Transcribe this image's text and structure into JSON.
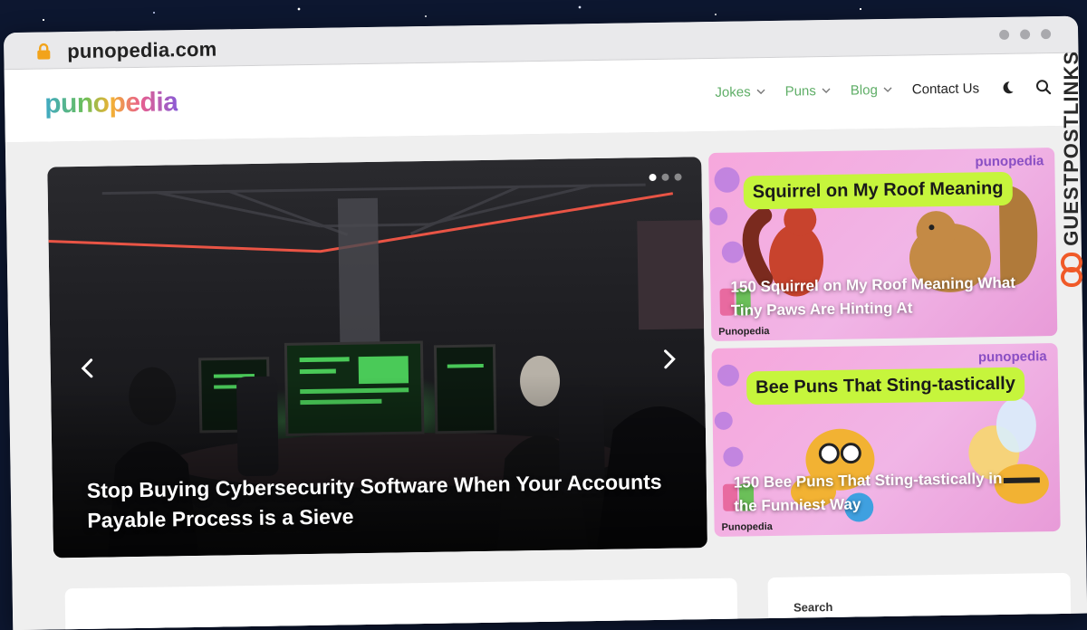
{
  "browser": {
    "url": "punopedia.com"
  },
  "site": {
    "logo": "punopedia"
  },
  "nav": {
    "items": [
      {
        "label": "Jokes",
        "has_dropdown": true
      },
      {
        "label": "Puns",
        "has_dropdown": true
      },
      {
        "label": "Blog",
        "has_dropdown": true
      },
      {
        "label": "Contact Us",
        "has_dropdown": false
      }
    ],
    "accent_color": "#5fae67"
  },
  "hero": {
    "title": "Stop Buying Cybersecurity Software When Your Accounts Payable Process is a Sieve",
    "slide_count": 3,
    "active_slide": 1
  },
  "cards": [
    {
      "brand": "punopedia",
      "banner": "Squirrel on My Roof Meaning",
      "title": "150 Squirrel on My Roof Meaning What Tiny Paws Are Hinting At",
      "footer": "Punopedia"
    },
    {
      "brand": "punopedia",
      "banner": "Bee Puns That Sting-tastically",
      "title": "150 Bee Puns That Sting-tastically in the Funniest Way",
      "footer": "Punopedia"
    }
  ],
  "sidebar": {
    "search_label": "Search"
  },
  "watermark": {
    "text": "GUESTPOSTLINKS"
  }
}
